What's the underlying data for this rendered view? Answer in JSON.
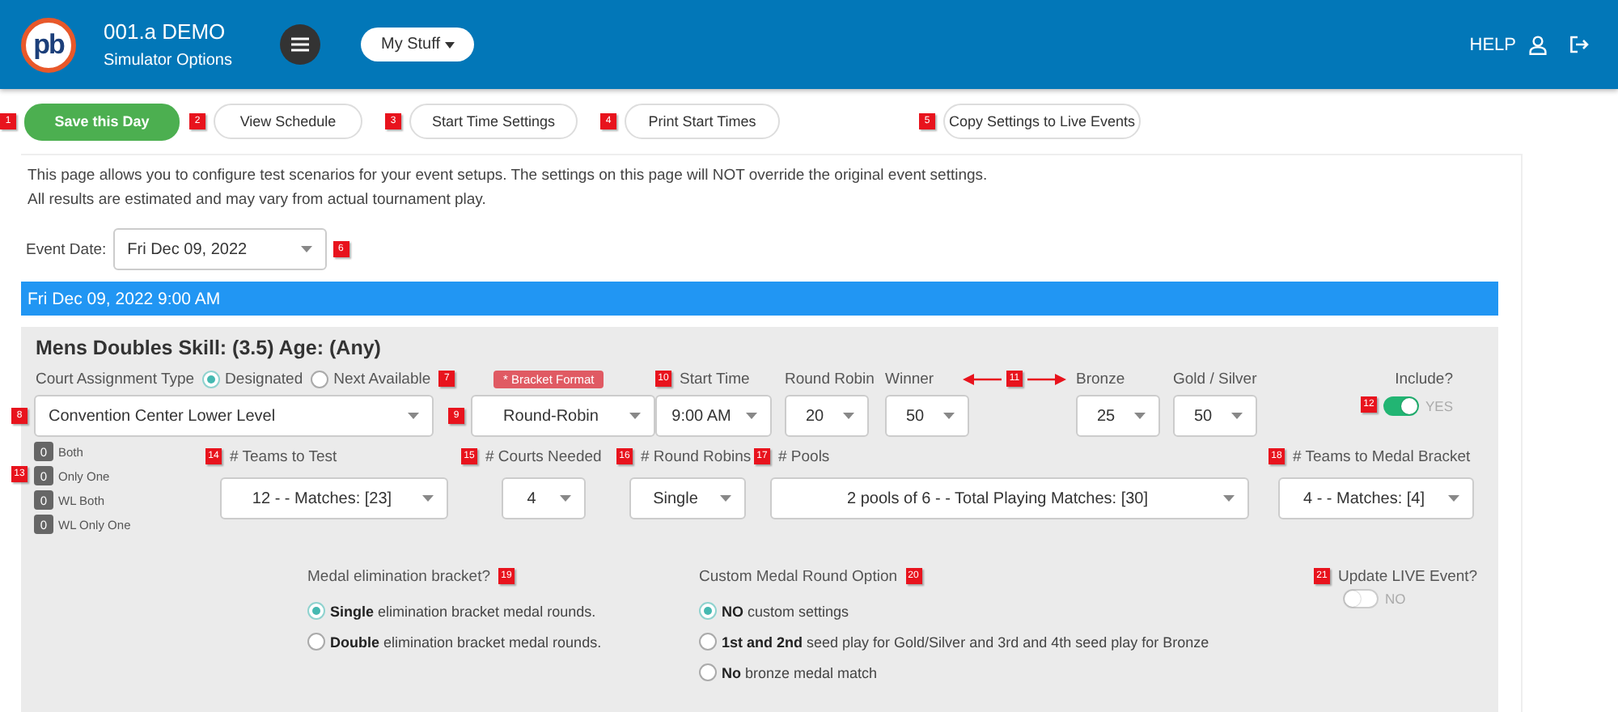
{
  "header": {
    "logo": "pb",
    "title": "001.a DEMO",
    "subtitle": "Simulator Options",
    "menu": "My Stuff",
    "help": "HELP"
  },
  "toolbar": [
    {
      "marker": "1",
      "label": "Save this Day",
      "kind": "primary"
    },
    {
      "marker": "2",
      "label": "View Schedule",
      "kind": "default"
    },
    {
      "marker": "3",
      "label": "Start Time Settings",
      "kind": "default"
    },
    {
      "marker": "4",
      "label": "Print Start Times",
      "kind": "default"
    },
    {
      "marker": "5",
      "label": "Copy Settings to Live Events",
      "kind": "default"
    }
  ],
  "intro": [
    "This page allows you to configure test scenarios for your event setups. The settings on this page will NOT override the original event settings.",
    "All results are estimated and may vary from actual tournament play."
  ],
  "event_date": {
    "label": "Event Date:",
    "value": "Fri Dec 09, 2022",
    "marker": "6"
  },
  "session_bar": "Fri Dec 09, 2022 9:00 AM",
  "event": {
    "title": "Mens Doubles Skill: (3.5) Age: (Any)",
    "court_type": {
      "label": "Court Assignment Type",
      "marker": "7",
      "options": [
        {
          "label": "Designated",
          "selected": true
        },
        {
          "label": "Next Available",
          "selected": false
        }
      ]
    },
    "court": {
      "marker": "8",
      "value": "Convention Center Lower Level"
    },
    "bracket_format": {
      "marker": "9",
      "tag": "* Bracket Format",
      "value": "Round-Robin"
    },
    "start_time": {
      "marker": "10",
      "label": "Start Time",
      "value": "9:00 AM"
    },
    "scores": [
      {
        "label": "Round Robin",
        "value": "20"
      },
      {
        "label": "Winner",
        "value": "50"
      },
      {
        "label": "Bronze",
        "value": "25"
      },
      {
        "label": "Gold / Silver",
        "value": "50"
      }
    ],
    "score_marker": "11",
    "include": {
      "label": "Include?",
      "marker": "12",
      "on": true,
      "state_text": "YES"
    },
    "counts": {
      "marker": "13",
      "items": [
        {
          "count": "0",
          "label": "Both"
        },
        {
          "count": "0",
          "label": "Only One"
        },
        {
          "count": "0",
          "label": "WL Both"
        },
        {
          "count": "0",
          "label": "WL Only One"
        }
      ]
    },
    "fields": [
      {
        "marker": "14",
        "label": "# Teams to Test",
        "value": "12 - - Matches: [23]"
      },
      {
        "marker": "15",
        "label": "# Courts Needed",
        "value": "4"
      },
      {
        "marker": "16",
        "label": "# Round Robins",
        "value": "Single"
      },
      {
        "marker": "17",
        "label": "# Pools",
        "value": "2 pools of 6 - - Total Playing Matches: [30]"
      },
      {
        "marker": "18",
        "label": "# Teams to Medal Bracket",
        "value": "4 - - Matches: [4]"
      }
    ],
    "medal_elimination": {
      "label": "Medal elimination bracket?",
      "marker": "19",
      "options": [
        {
          "label": "**Single** elimination bracket medal rounds.",
          "selected": true
        },
        {
          "label": "**Double** elimination bracket medal rounds.",
          "selected": false
        }
      ]
    },
    "custom_medal": {
      "label": "Custom Medal Round Option",
      "marker": "20",
      "options": [
        {
          "label": "**NO** custom settings",
          "selected": true
        },
        {
          "label": "**1st and 2nd** seed play for Gold/Silver and 3rd and 4th seed play for Bronze",
          "selected": false
        },
        {
          "label": "**No** bronze medal match",
          "selected": false
        }
      ]
    },
    "update_live": {
      "label": "Update LIVE Event?",
      "marker": "21",
      "on": false,
      "state_text": "NO"
    }
  }
}
